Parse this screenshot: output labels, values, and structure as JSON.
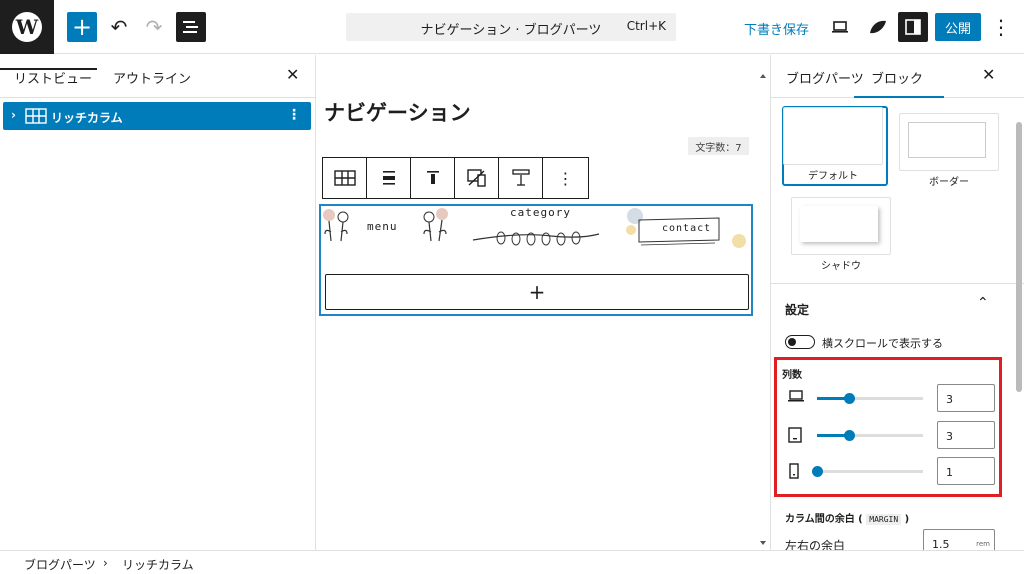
{
  "toolbar": {
    "command_title": "ナビゲーション · ブログパーツ",
    "command_shortcut": "Ctrl+K",
    "draft_label": "下書き保存",
    "publish_label": "公開",
    "accent": "#007cba"
  },
  "left_panel": {
    "tabs": [
      {
        "label": "リストビュー"
      },
      {
        "label": "アウトライン"
      }
    ],
    "tree": [
      {
        "label": "リッチカラム"
      }
    ]
  },
  "canvas": {
    "title": "ナビゲーション",
    "char_count": "文字数：7",
    "nav_items": [
      "menu",
      "category",
      "contact"
    ]
  },
  "right_panel": {
    "tabs": [
      {
        "label": "ブログパーツ"
      },
      {
        "label": "ブロック"
      }
    ],
    "styles": [
      {
        "label": "デフォルト"
      },
      {
        "label": "ボーダー"
      },
      {
        "label": "シャドウ"
      }
    ],
    "settings": {
      "heading": "設定",
      "scroll_toggle_label": "横スクロールで表示する",
      "columns_label": "列数",
      "columns": [
        {
          "device": "laptop-icon",
          "value": "3",
          "fraction": 0.3
        },
        {
          "device": "tablet-icon",
          "value": "3",
          "fraction": 0.3
        },
        {
          "device": "phone-icon",
          "value": "1",
          "fraction": 0.0
        }
      ],
      "gap_label": "カラム間の余白 (",
      "gap_code": "MARGIN",
      "gap_close": ")",
      "lr_label": "左右の余白",
      "lr_value": "1.5",
      "lr_unit": "rem"
    },
    "highlight_color": "#e21e25"
  },
  "breadcrumb": [
    {
      "label": "ブログパーツ"
    },
    {
      "label": "リッチカラム"
    }
  ]
}
